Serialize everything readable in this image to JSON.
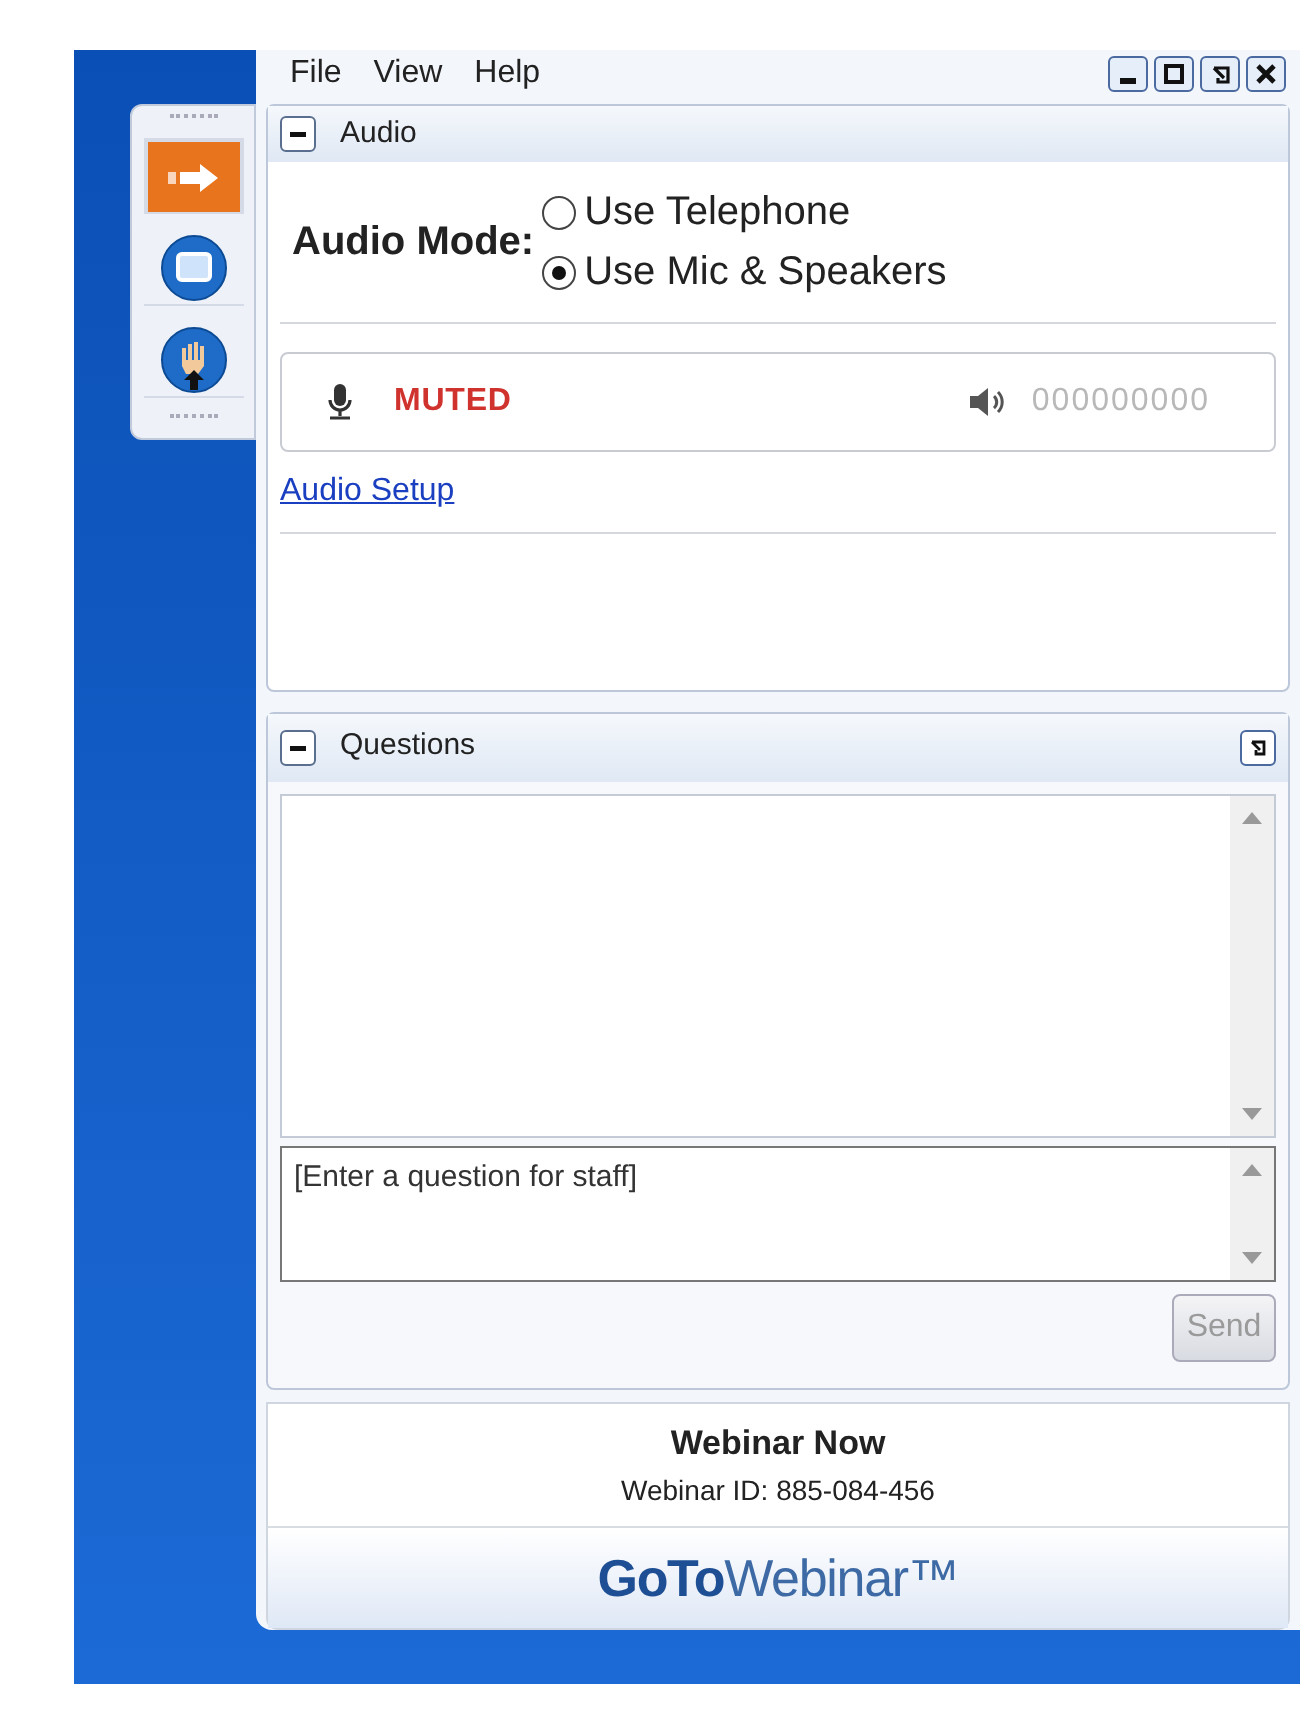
{
  "menu": [
    "File",
    "View",
    "Help"
  ],
  "toolbar": [
    {
      "kind": "arrow",
      "selected": true
    },
    {
      "kind": "screen",
      "selected": false
    },
    {
      "kind": "hand",
      "selected": false
    }
  ],
  "audio": {
    "title": "Audio",
    "expanded": true,
    "mode_label": "Audio Mode:",
    "options": [
      {
        "label": "Use Telephone",
        "selected": false
      },
      {
        "label": "Use Mic & Speakers",
        "selected": true
      }
    ],
    "mic_status": "MUTED",
    "speaker_level": "000000000",
    "setup_link": "Audio Setup"
  },
  "questions": {
    "title": "Questions",
    "expanded": true,
    "input": {
      "placeholder": "[Enter a question for staff]"
    },
    "send": {
      "label": "Send",
      "disabled": true
    }
  },
  "footer": {
    "title": "Webinar Now",
    "webinar_id": "Webinar ID: 885-084-456",
    "logo": "**GoTo**Webinar™"
  }
}
